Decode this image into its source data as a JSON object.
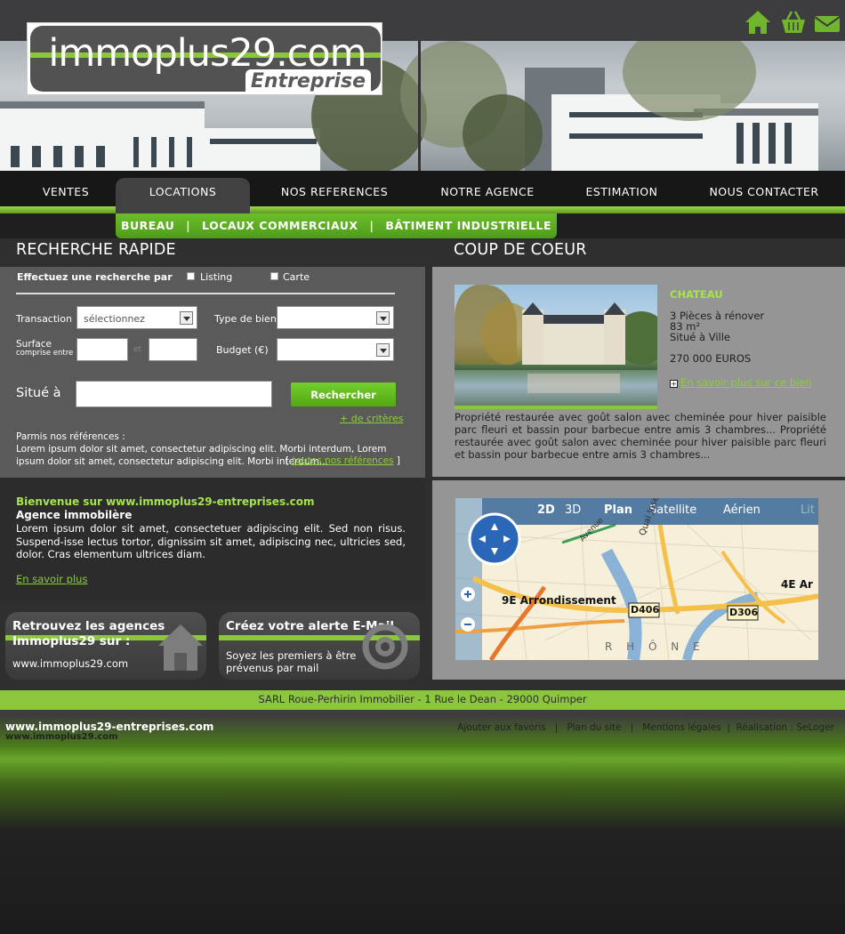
{
  "brand": {
    "logo_name": "immoplus29.com",
    "logo_sub": "Entreprise"
  },
  "top_icons": [
    {
      "icon": "home-icon"
    },
    {
      "icon": "basket-icon"
    },
    {
      "icon": "mail-icon"
    }
  ],
  "nav": {
    "items": [
      {
        "label": "VENTES"
      },
      {
        "label": "LOCATIONS",
        "active": true
      },
      {
        "label": "NOS REFERENCES"
      },
      {
        "label": "NOTRE AGENCE"
      },
      {
        "label": "ESTIMATION"
      },
      {
        "label": "NOUS CONTACTER"
      }
    ],
    "sub_items": [
      {
        "label": "BUREAU"
      },
      {
        "label": "LOCAUX COMMERCIAUX"
      },
      {
        "label": "BÂTIMENT INDUSTRIELLE"
      }
    ],
    "sub_sep": "|"
  },
  "search": {
    "title": "RECHERCHE RAPIDE",
    "by_label": "Effectuez une recherche par",
    "opt_listing": "Listing",
    "opt_carte": "Carte",
    "transaction_label": "Transaction",
    "transaction_value": "sélectionnez",
    "type_label": "Type de bien",
    "surface_label": "Surface",
    "surface_sub": "comprise entre",
    "et": "et",
    "budget_label": "Budget (€)",
    "situe_label": "Situé à",
    "button": "Rechercher",
    "more": "+ de critères",
    "refs_label": "Parmis nos références :",
    "refs_text": "Lorem ipsum dolor sit amet, consectetur adipiscing elit. Morbi interdum, Lorem ipsum dolor sit amet, consectetur adipiscing elit. Morbi interdum...",
    "refs_link": "toutes nos références",
    "bracket_open": "[",
    "bracket_close": "]"
  },
  "welcome": {
    "title": "Bienvenue sur www.immoplus29-entreprises.com",
    "subtitle": "Agence immobilère",
    "text": "Lorem ipsum dolor sit amet, consectetuer adipiscing elit. Sed non risus. Suspend-isse lectus tortor, dignissim sit amet, adipiscing nec, ultricies sed, dolor. Cras elementum ultrices diam.",
    "link": "En savoir plus"
  },
  "promos": [
    {
      "title": "Retrouvez les agences Immoplus29 sur :",
      "text": "www.immoplus29.com",
      "icon": "house-icon"
    },
    {
      "title": "Créez votre alerte E-Mail.",
      "text": "Soyez les premiers à être prévenus par mail",
      "icon": "at-sign-icon"
    }
  ],
  "coup": {
    "title": "COUP DE COEUR",
    "type": "CHATEAU",
    "line1": "3 Pièces à rénover",
    "line2": "83 m²",
    "line3": "Situé à Ville",
    "price": "270 000 EUROS",
    "link": "En savoir plus sur ce bien",
    "description": "Propriété restaurée avec goût salon avec cheminée pour hiver paisible parc fleuri et bassin pour barbecue entre amis 3 chambres... Propriété restaurée avec goût salon avec cheminée pour hiver paisible parc fleuri et bassin pour barbecue entre amis 3 chambres..."
  },
  "map": {
    "tabs": [
      "2D",
      "3D",
      "Plan",
      "Satellite",
      "Aérien",
      "Lit"
    ],
    "label_arr": "9E Arrondissement",
    "label_arr2": "4E Ar",
    "road1": "D406",
    "road2": "D306",
    "river": "R H Ô N E",
    "street": "Quai Joseph",
    "street2": "Avenue"
  },
  "footer": {
    "address": "SARL Roue-Perhirin Immobilier - 1 Rue le Dean - 29000 Quimper",
    "site1": "www.immoplus29-entreprises.com",
    "site2": "www.immoplus29.com",
    "links": [
      "Ajouter aux favoris",
      "Plan du site",
      "Mentions légales",
      "Réalisation : SeLoger"
    ],
    "sep": "|"
  },
  "colors": {
    "accent": "#8cc63f",
    "dark": "#2f2f2f"
  }
}
